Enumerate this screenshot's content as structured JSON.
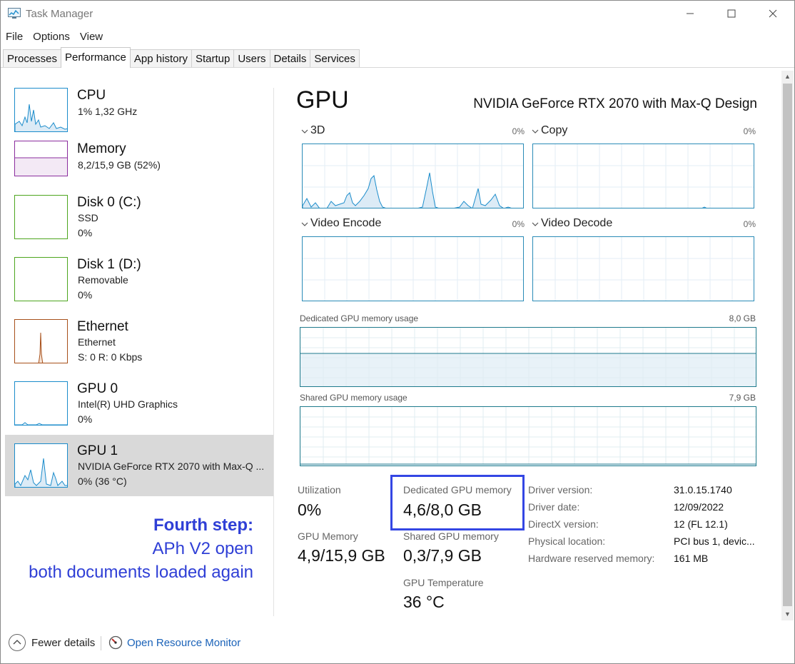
{
  "window": {
    "title": "Task Manager"
  },
  "menu": [
    "File",
    "Options",
    "View"
  ],
  "tabs": [
    "Processes",
    "Performance",
    "App history",
    "Startup",
    "Users",
    "Details",
    "Services"
  ],
  "active_tab": "Performance",
  "sidebar": [
    {
      "title": "CPU",
      "lines": [
        "1%  1,32 GHz"
      ],
      "color": "#1b8ccb",
      "selected": false
    },
    {
      "title": "Memory",
      "lines": [
        "8,2/15,9 GB (52%)"
      ],
      "color": "#8b2d9e",
      "selected": false
    },
    {
      "title": "Disk 0 (C:)",
      "lines": [
        "SSD",
        "0%"
      ],
      "color": "#4da61e",
      "selected": false
    },
    {
      "title": "Disk 1 (D:)",
      "lines": [
        "Removable",
        "0%"
      ],
      "color": "#4da61e",
      "selected": false
    },
    {
      "title": "Ethernet",
      "lines": [
        "Ethernet",
        "S: 0  R: 0 Kbps"
      ],
      "color": "#a7501a",
      "selected": false
    },
    {
      "title": "GPU 0",
      "lines": [
        "Intel(R) UHD Graphics",
        "0%"
      ],
      "color": "#1b8ccb",
      "selected": false
    },
    {
      "title": "GPU 1",
      "lines": [
        "NVIDIA GeForce RTX 2070 with Max-Q ...",
        "0% (36 °C)"
      ],
      "color": "#1b8ccb",
      "selected": true
    }
  ],
  "main": {
    "title": "GPU",
    "device": "NVIDIA GeForce RTX 2070 with Max-Q Design",
    "engines": [
      {
        "name": "3D",
        "percent": "0%"
      },
      {
        "name": "Copy",
        "percent": "0%"
      },
      {
        "name": "Video Encode",
        "percent": "0%"
      },
      {
        "name": "Video Decode",
        "percent": "0%"
      }
    ],
    "dedicated_usage": {
      "label": "Dedicated GPU memory usage",
      "max": "8,0 GB"
    },
    "shared_usage": {
      "label": "Shared GPU memory usage",
      "max": "7,9 GB"
    },
    "stats": {
      "utilization": {
        "label": "Utilization",
        "value": "0%"
      },
      "gpu_memory": {
        "label": "GPU Memory",
        "value": "4,9/15,9 GB"
      },
      "dedicated": {
        "label": "Dedicated GPU memory",
        "value": "4,6/8,0 GB"
      },
      "shared": {
        "label": "Shared GPU memory",
        "value": "0,3/7,9 GB"
      },
      "temperature": {
        "label": "GPU Temperature",
        "value": "36 °C"
      }
    },
    "info": [
      {
        "label": "Driver version:",
        "value": "31.0.15.1740"
      },
      {
        "label": "Driver date:",
        "value": "12/09/2022"
      },
      {
        "label": "DirectX version:",
        "value": "12 (FL 12.1)"
      },
      {
        "label": "Physical location:",
        "value": "PCI bus 1, devic..."
      },
      {
        "label": "Hardware reserved memory:",
        "value": "161 MB"
      }
    ]
  },
  "annotation": {
    "line1": "Fourth step:",
    "line2": "APh V2 open",
    "line3": "both documents loaded again"
  },
  "footer": {
    "fewer_details": "Fewer details",
    "open_resmon": "Open Resource Monitor"
  },
  "colors": {
    "accent": "#1b8ccb",
    "highlight": "#3446e4",
    "annotation": "#2f3fd6",
    "link": "#1a62b8"
  }
}
